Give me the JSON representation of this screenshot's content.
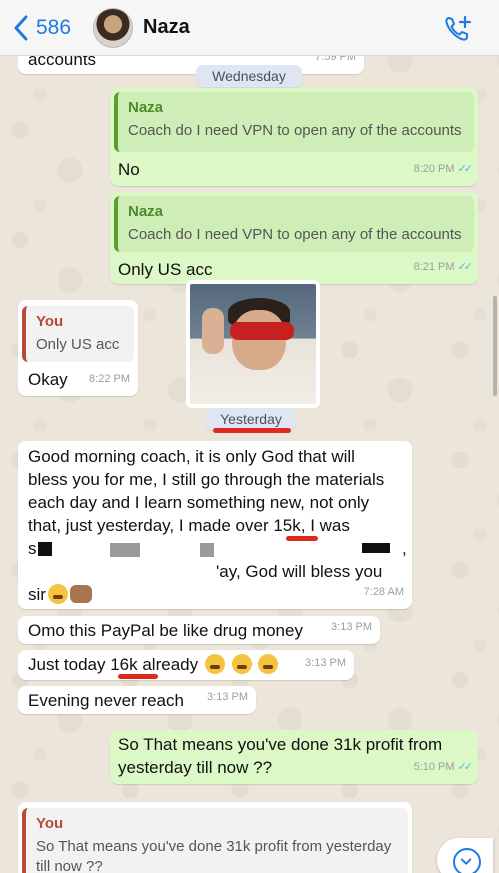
{
  "header": {
    "back_count": "586",
    "contact_name": "Naza"
  },
  "messages": {
    "m0": {
      "text": "accounts",
      "time": "7:59 PM"
    },
    "day_wed": "Wednesday",
    "m1": {
      "quote_name": "Naza",
      "quote_text": "Coach do I need VPN to open any of the accounts",
      "text": "No",
      "time": "8:20 PM"
    },
    "m2": {
      "quote_name": "Naza",
      "quote_text": "Coach do I need VPN to open any of the accounts",
      "text": "Only US acc",
      "time": "8:21 PM"
    },
    "m3": {
      "quote_name": "You",
      "quote_text": "Only US acc",
      "text": "Okay",
      "time": "8:22 PM"
    },
    "day_yesterday": "Yesterday",
    "m4": {
      "line1": "Good morning coach, it is only God that will",
      "line2": "bless you for me, I still go through the materials",
      "line3": "each day and I learn something new, not only",
      "line4": "that, just yesterday, I made over 15k, I was",
      "line5a": "s",
      "line5b": ",",
      "line6": "'ay, God will bless you",
      "line7": "sir",
      "time": "7:28 AM"
    },
    "m5": {
      "text": "Omo this PayPal be like drug money",
      "time": "3:13 PM"
    },
    "m6": {
      "text": "Just today 16k already",
      "time": "3:13 PM"
    },
    "m7": {
      "text": "Evening never reach",
      "time": "3:13 PM"
    },
    "m8": {
      "line1": "So That means you've done 31k profit from",
      "line2": "yesterday till now ??",
      "time": "5:10 PM"
    },
    "m9": {
      "quote_name": "You",
      "quote_line1": "So That means you've done 31k profit from yesterday",
      "quote_line2": "till now ??"
    }
  },
  "icons": [
    "chevron-left-icon",
    "add-call-icon",
    "double-check-icon",
    "weary-face-icon",
    "folded-hands-icon",
    "chevron-down-icon"
  ],
  "colors": {
    "accent": "#1f7ae0",
    "outgoing": "#dcf8c6",
    "incoming": "#ffffff",
    "highlight": "#e0281f"
  }
}
